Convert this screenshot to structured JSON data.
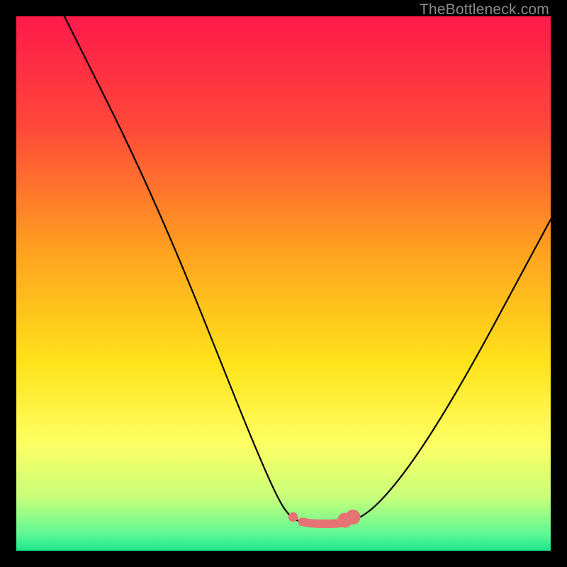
{
  "watermark": {
    "text": "TheBottleneck.com"
  },
  "chart_data": {
    "type": "line",
    "title": "",
    "xlabel": "",
    "ylabel": "",
    "xlim": [
      0,
      100
    ],
    "ylim": [
      0,
      100
    ],
    "grid": false,
    "legend": false,
    "background_gradient_stops": [
      {
        "pos": 0,
        "color": "#ff1a4b"
      },
      {
        "pos": 20,
        "color": "#ff463a"
      },
      {
        "pos": 45,
        "color": "#ffa51e"
      },
      {
        "pos": 65,
        "color": "#ffe31a"
      },
      {
        "pos": 80,
        "color": "#fdff63"
      },
      {
        "pos": 90,
        "color": "#c8ff7a"
      },
      {
        "pos": 97,
        "color": "#5cf795"
      },
      {
        "pos": 100,
        "color": "#1be58e"
      }
    ],
    "series": [
      {
        "name": "left-curve",
        "color": "#000000",
        "points": [
          {
            "x": 9.0,
            "y": 100.0
          },
          {
            "x": 14.0,
            "y": 90.0
          },
          {
            "x": 20.0,
            "y": 78.0
          },
          {
            "x": 26.0,
            "y": 65.0
          },
          {
            "x": 32.0,
            "y": 51.0
          },
          {
            "x": 38.0,
            "y": 36.0
          },
          {
            "x": 44.0,
            "y": 21.0
          },
          {
            "x": 49.0,
            "y": 9.5
          },
          {
            "x": 51.5,
            "y": 6.0
          },
          {
            "x": 53.5,
            "y": 5.4
          }
        ]
      },
      {
        "name": "right-curve",
        "color": "#000000",
        "points": [
          {
            "x": 62.0,
            "y": 5.4
          },
          {
            "x": 64.5,
            "y": 6.2
          },
          {
            "x": 68.0,
            "y": 9.0
          },
          {
            "x": 73.0,
            "y": 15.0
          },
          {
            "x": 79.0,
            "y": 24.0
          },
          {
            "x": 86.0,
            "y": 36.0
          },
          {
            "x": 93.0,
            "y": 49.0
          },
          {
            "x": 100.0,
            "y": 62.0
          }
        ]
      },
      {
        "name": "bottom-flat",
        "color": "#e57373",
        "points": [
          {
            "x": 53.5,
            "y": 5.4
          },
          {
            "x": 55.0,
            "y": 5.1
          },
          {
            "x": 58.0,
            "y": 5.0
          },
          {
            "x": 60.5,
            "y": 5.1
          },
          {
            "x": 62.0,
            "y": 5.4
          }
        ]
      }
    ],
    "markers": [
      {
        "x": 51.8,
        "y": 6.3,
        "r": 0.9,
        "color": "#e57373"
      },
      {
        "x": 61.5,
        "y": 5.7,
        "r": 1.4,
        "color": "#e57373"
      },
      {
        "x": 63.0,
        "y": 6.3,
        "r": 1.4,
        "color": "#e57373"
      }
    ]
  }
}
